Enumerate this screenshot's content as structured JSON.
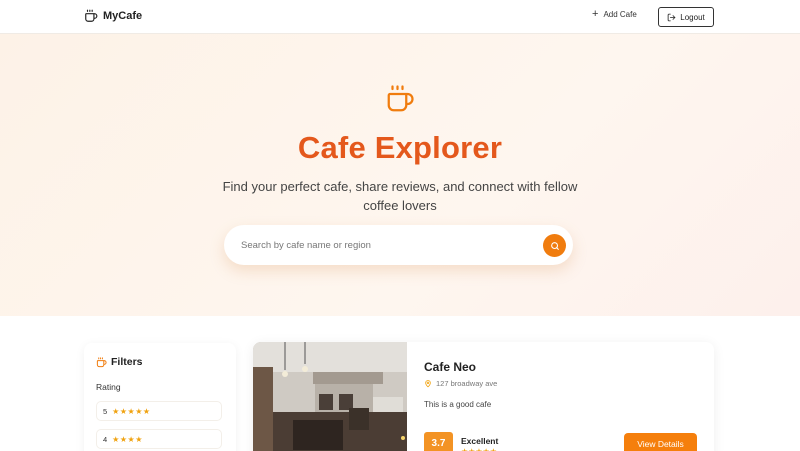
{
  "header": {
    "brand": "MyCafe",
    "add_cafe": "Add Cafe",
    "logout": "Logout"
  },
  "hero": {
    "title": "Cafe Explorer",
    "subtitle": "Find your perfect cafe, share reviews, and connect with fellow coffee lovers",
    "search_placeholder": "Search by cafe name or region"
  },
  "filters": {
    "title": "Filters",
    "rating_label": "Rating",
    "options": [
      {
        "value": "5",
        "stars": "★★★★★"
      },
      {
        "value": "4",
        "stars": "★★★★"
      }
    ]
  },
  "cafe": {
    "name": "Cafe Neo",
    "address": "127 broadway ave",
    "description": "This is a good cafe",
    "score": "3.7",
    "score_label": "Excellent",
    "stars": "★★★★★",
    "view_details": "View Details"
  },
  "colors": {
    "accent": "#e4581c",
    "button": "#f57f0c",
    "star": "#f0a20f"
  },
  "icons": {
    "brand": "coffee-cup-icon",
    "add": "plus-icon",
    "logout": "logout-icon",
    "search": "search-icon",
    "filters": "coffee-cup-icon",
    "address": "map-pin-icon"
  }
}
